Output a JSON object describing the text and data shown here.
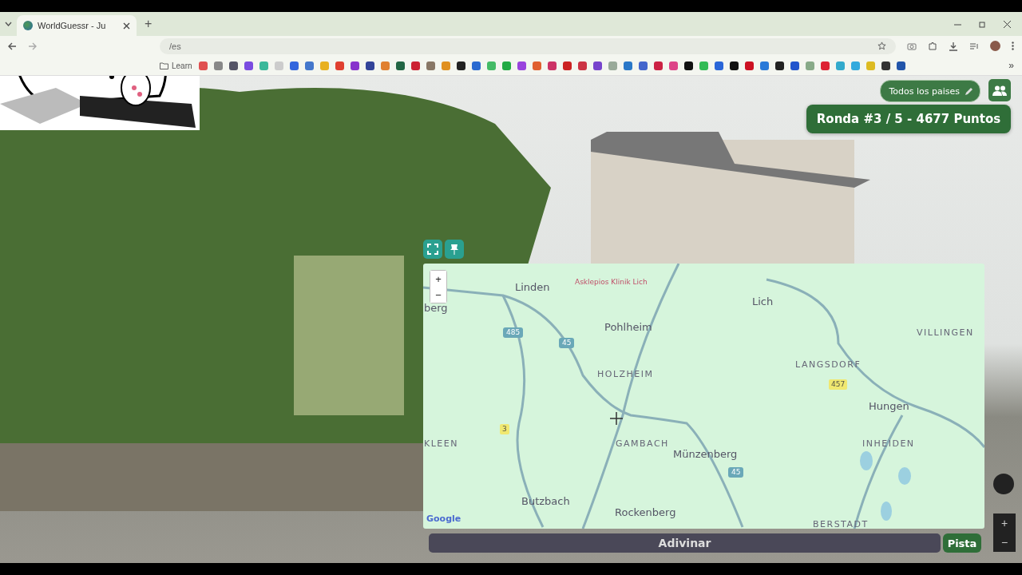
{
  "browser": {
    "tab": {
      "title": "WorldGuessr - Ju",
      "selected": true
    },
    "new_tab": "+",
    "address": "/es",
    "bookmark_folder": "Learn",
    "more_bookmarks": "»"
  },
  "game": {
    "region_filter": "Todos los paises",
    "round_banner": "Ronda #3 / 5 - 4677 Puntos",
    "map": {
      "zoom_in": "+",
      "zoom_out": "−",
      "attribution": "Google",
      "labels": [
        {
          "text": "Linden",
          "kind": "town"
        },
        {
          "text": "berg",
          "kind": "town"
        },
        {
          "text": "Asklepios Klinik Lich",
          "kind": "poi"
        },
        {
          "text": "Lich",
          "kind": "town"
        },
        {
          "text": "Pohlheim",
          "kind": "town"
        },
        {
          "text": "VILLINGEN",
          "kind": "district"
        },
        {
          "text": "HOLZHEIM",
          "kind": "district"
        },
        {
          "text": "LANGSDORF",
          "kind": "district"
        },
        {
          "text": "485",
          "kind": "shield"
        },
        {
          "text": "45",
          "kind": "shield"
        },
        {
          "text": "457",
          "kind": "roadnum"
        },
        {
          "text": "Hungen",
          "kind": "town"
        },
        {
          "text": "3",
          "kind": "roadnum"
        },
        {
          "text": "KLEEN",
          "kind": "district"
        },
        {
          "text": "GAMBACH",
          "kind": "district"
        },
        {
          "text": "INHEIDEN",
          "kind": "district"
        },
        {
          "text": "Münzenberg",
          "kind": "town"
        },
        {
          "text": "45",
          "kind": "shield"
        },
        {
          "text": "Butzbach",
          "kind": "town"
        },
        {
          "text": "Rockenberg",
          "kind": "town"
        },
        {
          "text": "BERSTADT",
          "kind": "district"
        }
      ]
    },
    "guess_button": "Adivinar",
    "hint_button": "Pista",
    "view_zoom_in": "+",
    "view_zoom_out": "−"
  }
}
